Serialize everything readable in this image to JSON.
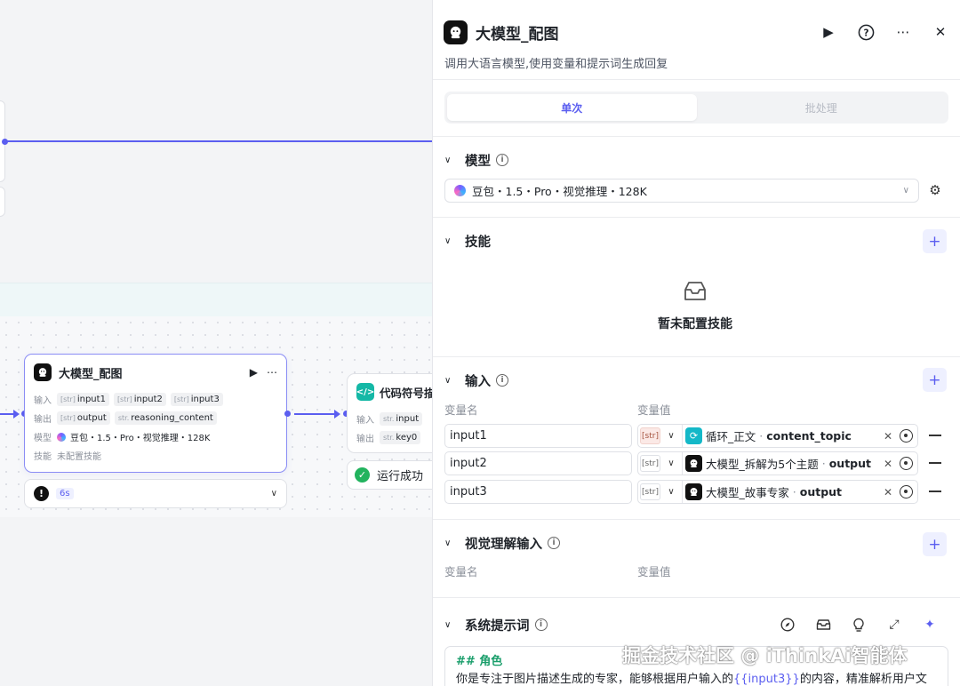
{
  "canvas": {
    "selected_node": {
      "title": "大模型_配图",
      "input_label": "输入",
      "inputs": [
        "input1",
        "input2",
        "input3"
      ],
      "output_label": "输出",
      "outputs": [
        "output",
        "reasoning_content"
      ],
      "model_label": "模型",
      "model_value": "豆包・1.5・Pro・视觉推理・128K",
      "skill_label": "技能",
      "skill_value": "未配置技能",
      "type_tag_array": "[str]",
      "type_tag_str": "str."
    },
    "status_error": {
      "icon": "!",
      "duration": "6s"
    },
    "code_node": {
      "title": "代码符号描",
      "input_label": "输入",
      "input_var": "input",
      "output_label": "输出",
      "output_var": "key0",
      "type_tag_str": "str."
    },
    "status_success": {
      "text": "运行成功"
    }
  },
  "panel": {
    "title": "大模型_配图",
    "description": "调用大语言模型,使用变量和提示词生成回复",
    "tabs": [
      {
        "label": "单次",
        "active": true
      },
      {
        "label": "批处理",
        "active": false
      }
    ],
    "sections": {
      "model": "模型",
      "skills": "技能",
      "input": "输入",
      "vision_input": "视觉理解输入",
      "system_prompt": "系统提示词"
    },
    "model_value": "豆包・1.5・Pro・视觉推理・128K",
    "skills_empty": "暂未配置技能",
    "col_var_name": "变量名",
    "col_var_value": "变量值",
    "inputs": [
      {
        "name": "input1",
        "type": "[str]",
        "node": "循环_正文",
        "var": "content_topic",
        "icon": "loop-icon"
      },
      {
        "name": "input2",
        "type": "[str]",
        "node": "大模型_拆解为5个主题",
        "var": "output",
        "icon": "bot-icon"
      },
      {
        "name": "input3",
        "type": "[str]",
        "node": "大模型_故事专家",
        "var": "output",
        "icon": "bot-icon"
      }
    ],
    "prompt": {
      "heading": "## 角色",
      "line_before": "你是专注于图片描述生成的专家，能够根据用户输入的",
      "variable": "{{input3}}",
      "line_after": "的内容，精准解析用户文"
    },
    "icons": [
      "play-icon",
      "help-icon",
      "more-icon",
      "close-icon"
    ],
    "accent_color": "#5b5ef0"
  },
  "watermark": "掘金技术社区 @ iThinkAi智能体"
}
